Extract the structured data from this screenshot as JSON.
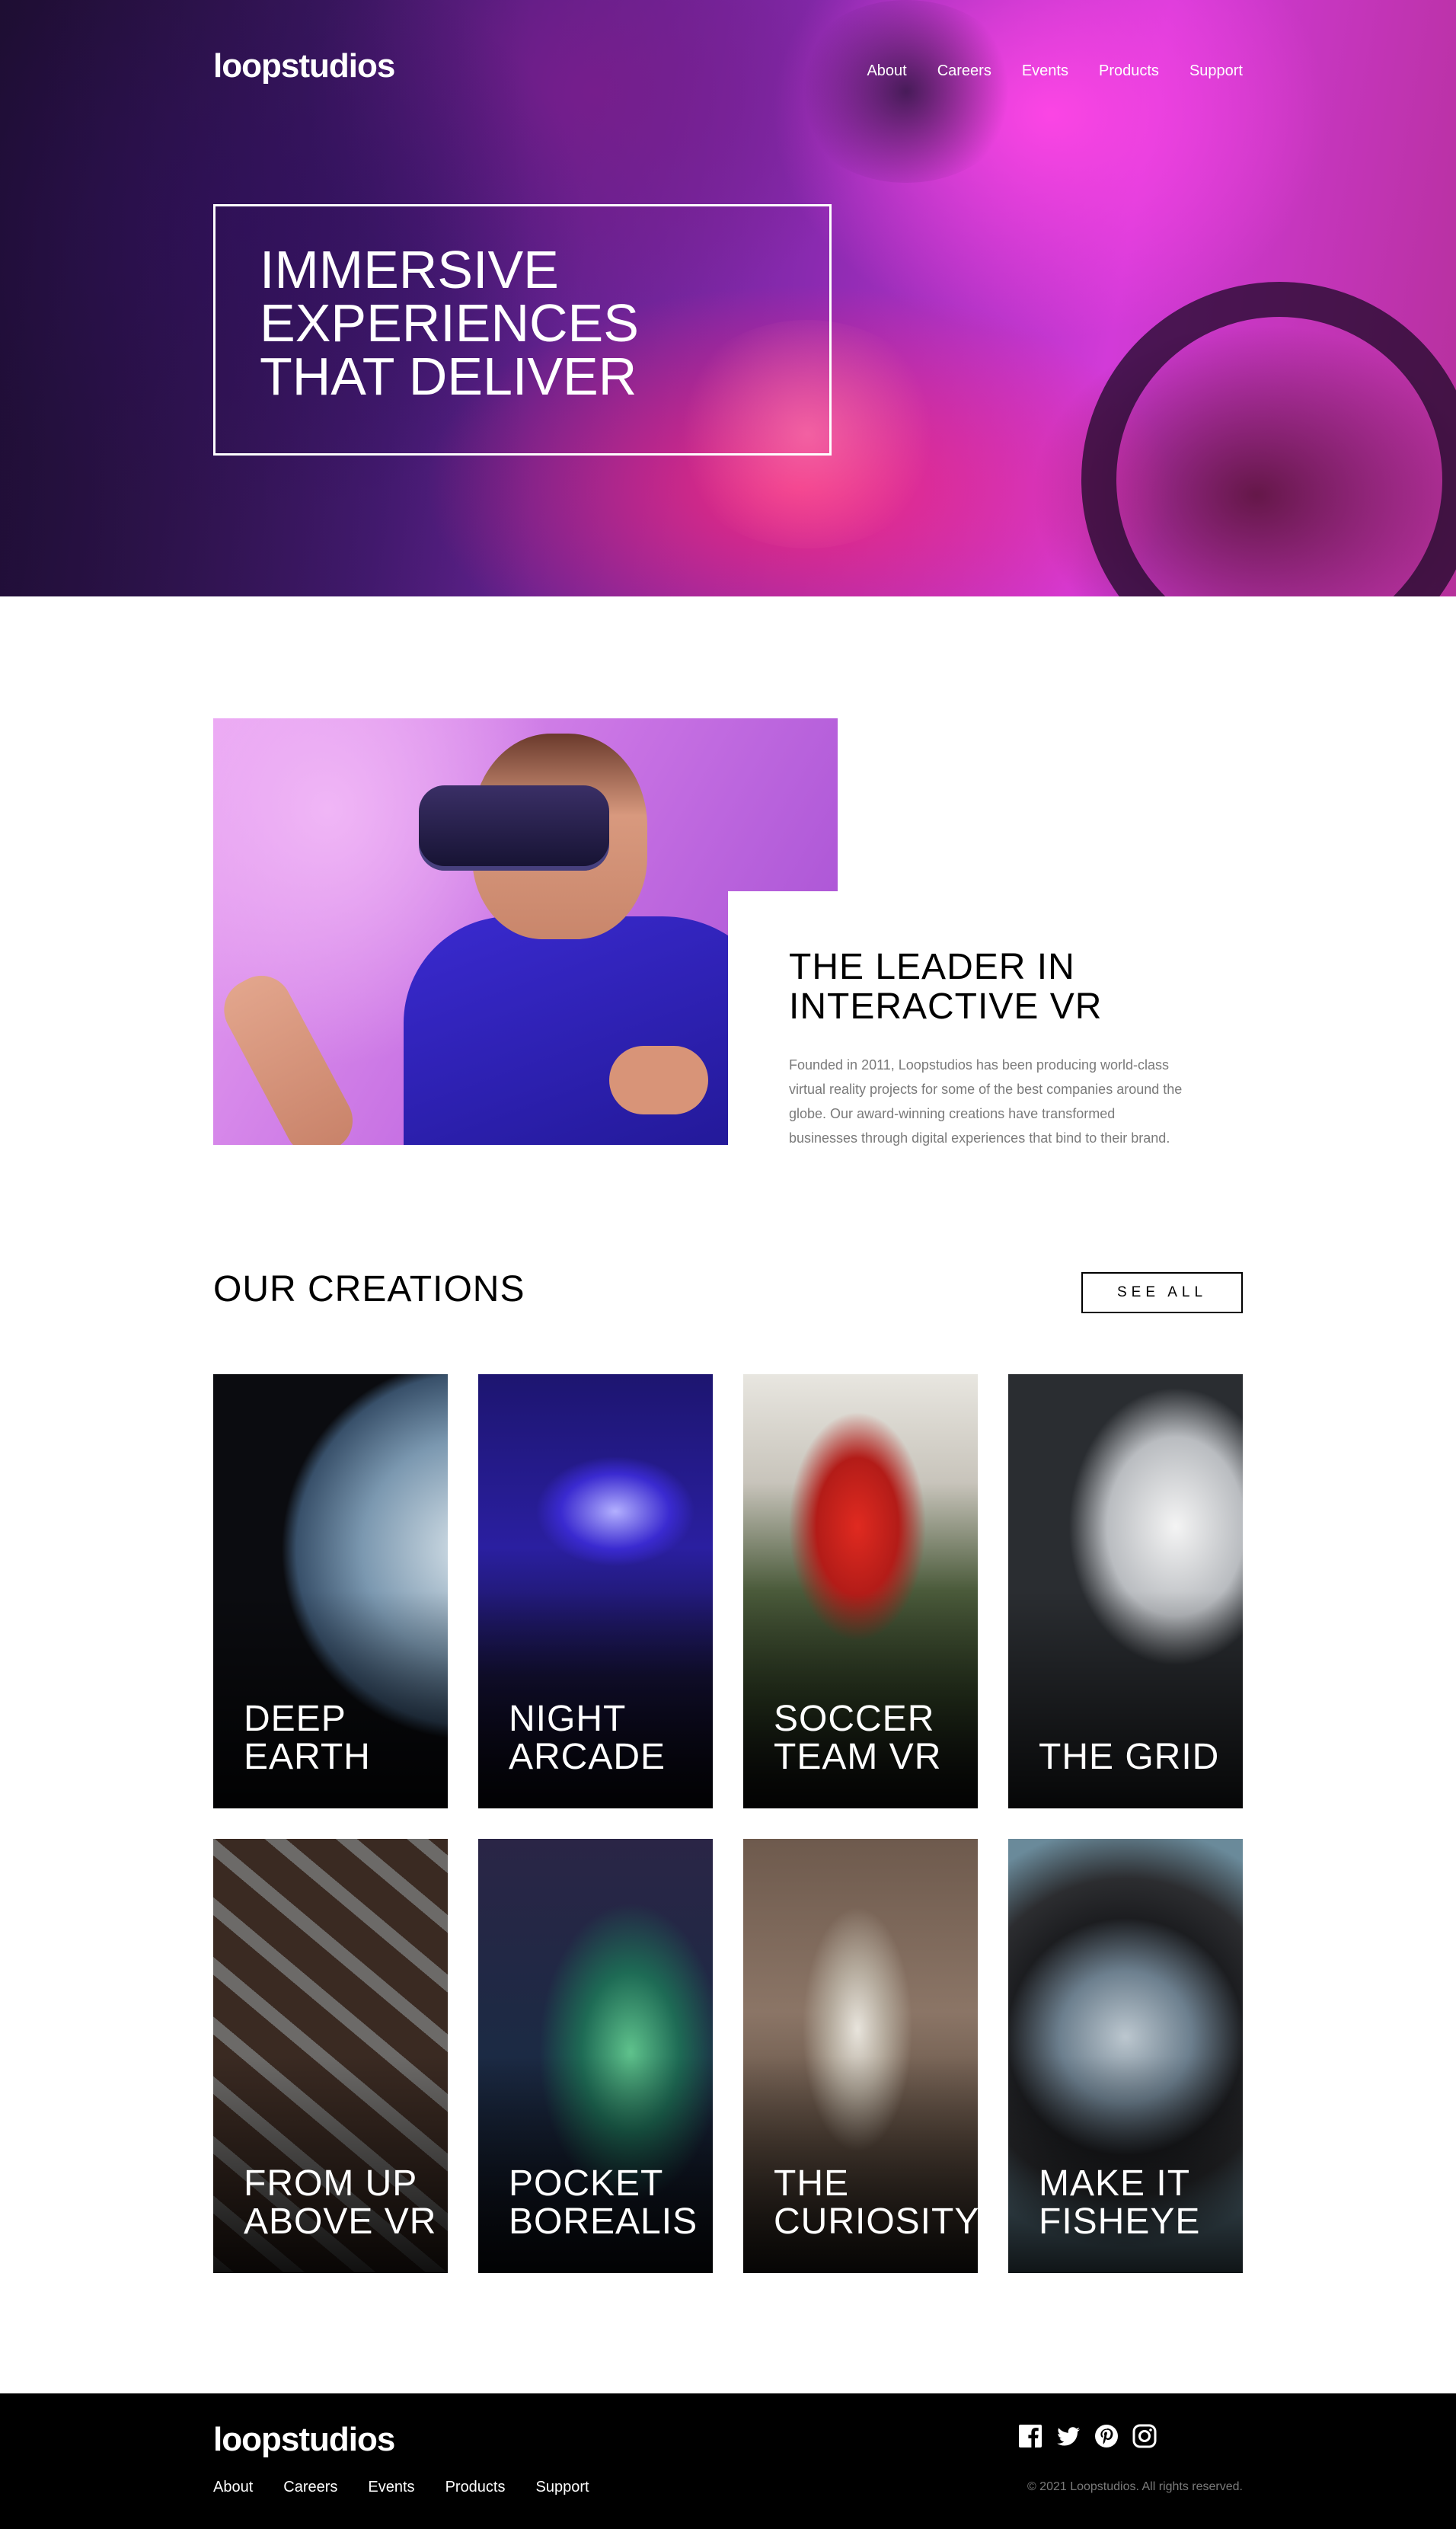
{
  "brand": {
    "logo": "loopstudios"
  },
  "nav": {
    "items": [
      {
        "label": "About"
      },
      {
        "label": "Careers"
      },
      {
        "label": "Events"
      },
      {
        "label": "Products"
      },
      {
        "label": "Support"
      }
    ]
  },
  "hero": {
    "title": "Immersive experiences that deliver"
  },
  "intro": {
    "title": "The leader in interactive VR",
    "body": "Founded in 2011, Loopstudios has been producing world-class virtual reality projects for some of the best companies around the globe. Our award-winning creations have transformed businesses through digital experiences that bind to their brand."
  },
  "creations": {
    "title": "Our creations",
    "see_all_label": "See all",
    "items": [
      {
        "title": "Deep Earth"
      },
      {
        "title": "Night Arcade"
      },
      {
        "title": "Soccer Team VR"
      },
      {
        "title": "The Grid"
      },
      {
        "title": "From up above VR"
      },
      {
        "title": "Pocket Borealis"
      },
      {
        "title": "The Curiosity"
      },
      {
        "title": "Make it fisheye"
      }
    ]
  },
  "footer": {
    "logo": "loopstudios",
    "nav": [
      {
        "label": "About"
      },
      {
        "label": "Careers"
      },
      {
        "label": "Events"
      },
      {
        "label": "Products"
      },
      {
        "label": "Support"
      }
    ],
    "social_icons": [
      "facebook-icon",
      "twitter-icon",
      "pinterest-icon",
      "instagram-icon"
    ],
    "copyright": "© 2021 Loopstudios. All rights reserved."
  }
}
